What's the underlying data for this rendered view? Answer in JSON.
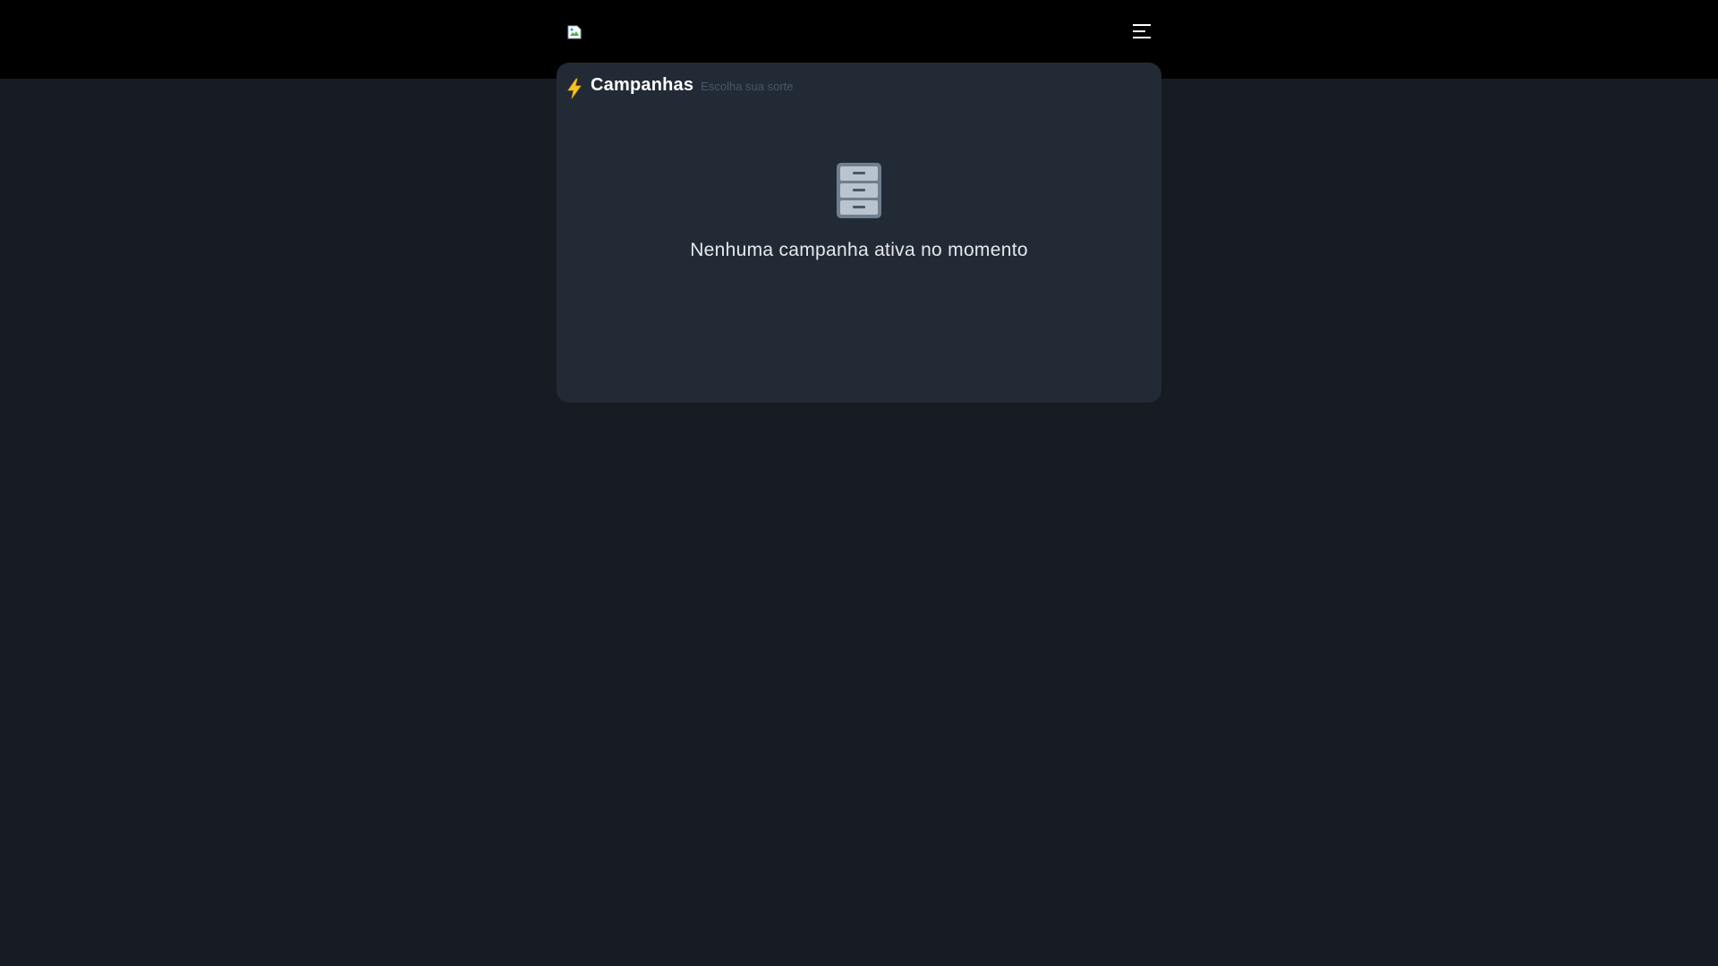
{
  "header": {
    "logo_icon": "broken-image-icon",
    "menu_icon": "menu-icon"
  },
  "campaigns": {
    "title_icon": "lightning-icon",
    "title": "Campanhas",
    "subtitle": "Escolha sua sorte",
    "empty_icon": "file-cabinet-icon",
    "empty_message": "Nenhuma campanha ativa no momento"
  },
  "colors": {
    "page_background": "#171c23",
    "topbar_background": "#000000",
    "card_background": "#222a35",
    "accent_yellow": "#f7c325"
  }
}
